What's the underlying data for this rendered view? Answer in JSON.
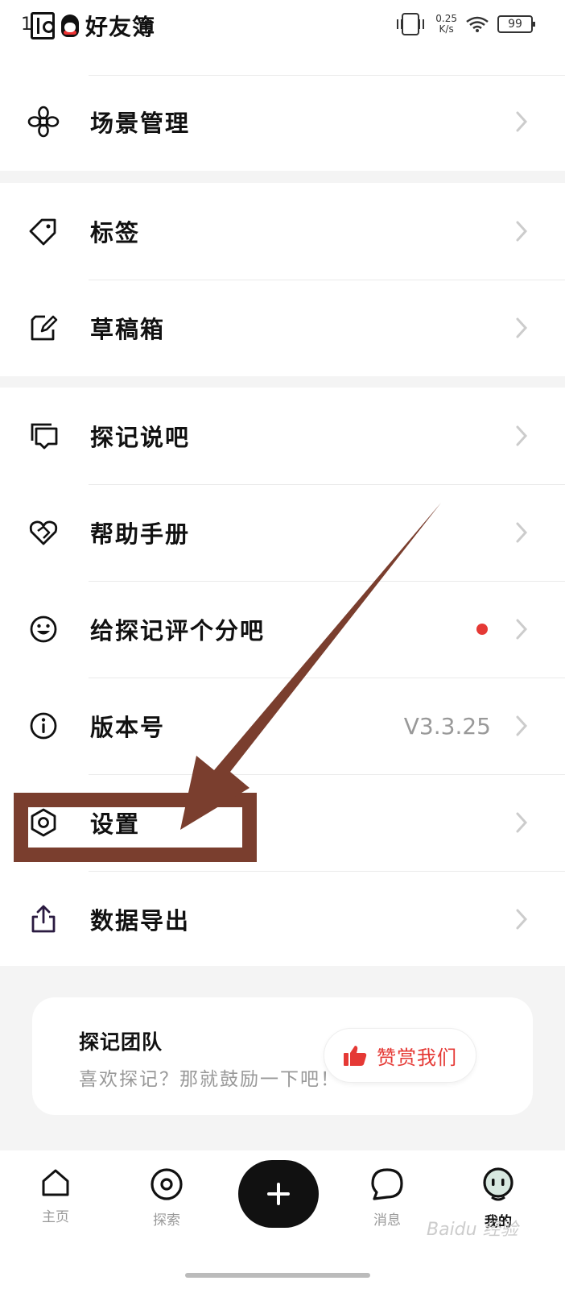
{
  "status_bar": {
    "time": "1",
    "app_title": "好友簿",
    "net_speed_value": "0.25",
    "net_speed_unit": "K/s",
    "battery": "99"
  },
  "menu": {
    "scene_management": "场景管理",
    "tags": "标签",
    "drafts": "草稿箱",
    "talk": "探记说吧",
    "help": "帮助手册",
    "rate": "给探记评个分吧",
    "version": "版本号",
    "version_value": "V3.3.25",
    "settings": "设置",
    "export": "数据导出"
  },
  "team_card": {
    "title": "探记团队",
    "subtitle": "喜欢探记？那就鼓励一下吧！",
    "reward_button": "赞赏我们"
  },
  "tab_bar": {
    "home": "主页",
    "explore": "探索",
    "messages": "消息",
    "mine": "我的"
  },
  "watermark": "Baidu 经验",
  "colors": {
    "accent_red": "#e53935",
    "annotation_brown": "#7a3e2e"
  }
}
